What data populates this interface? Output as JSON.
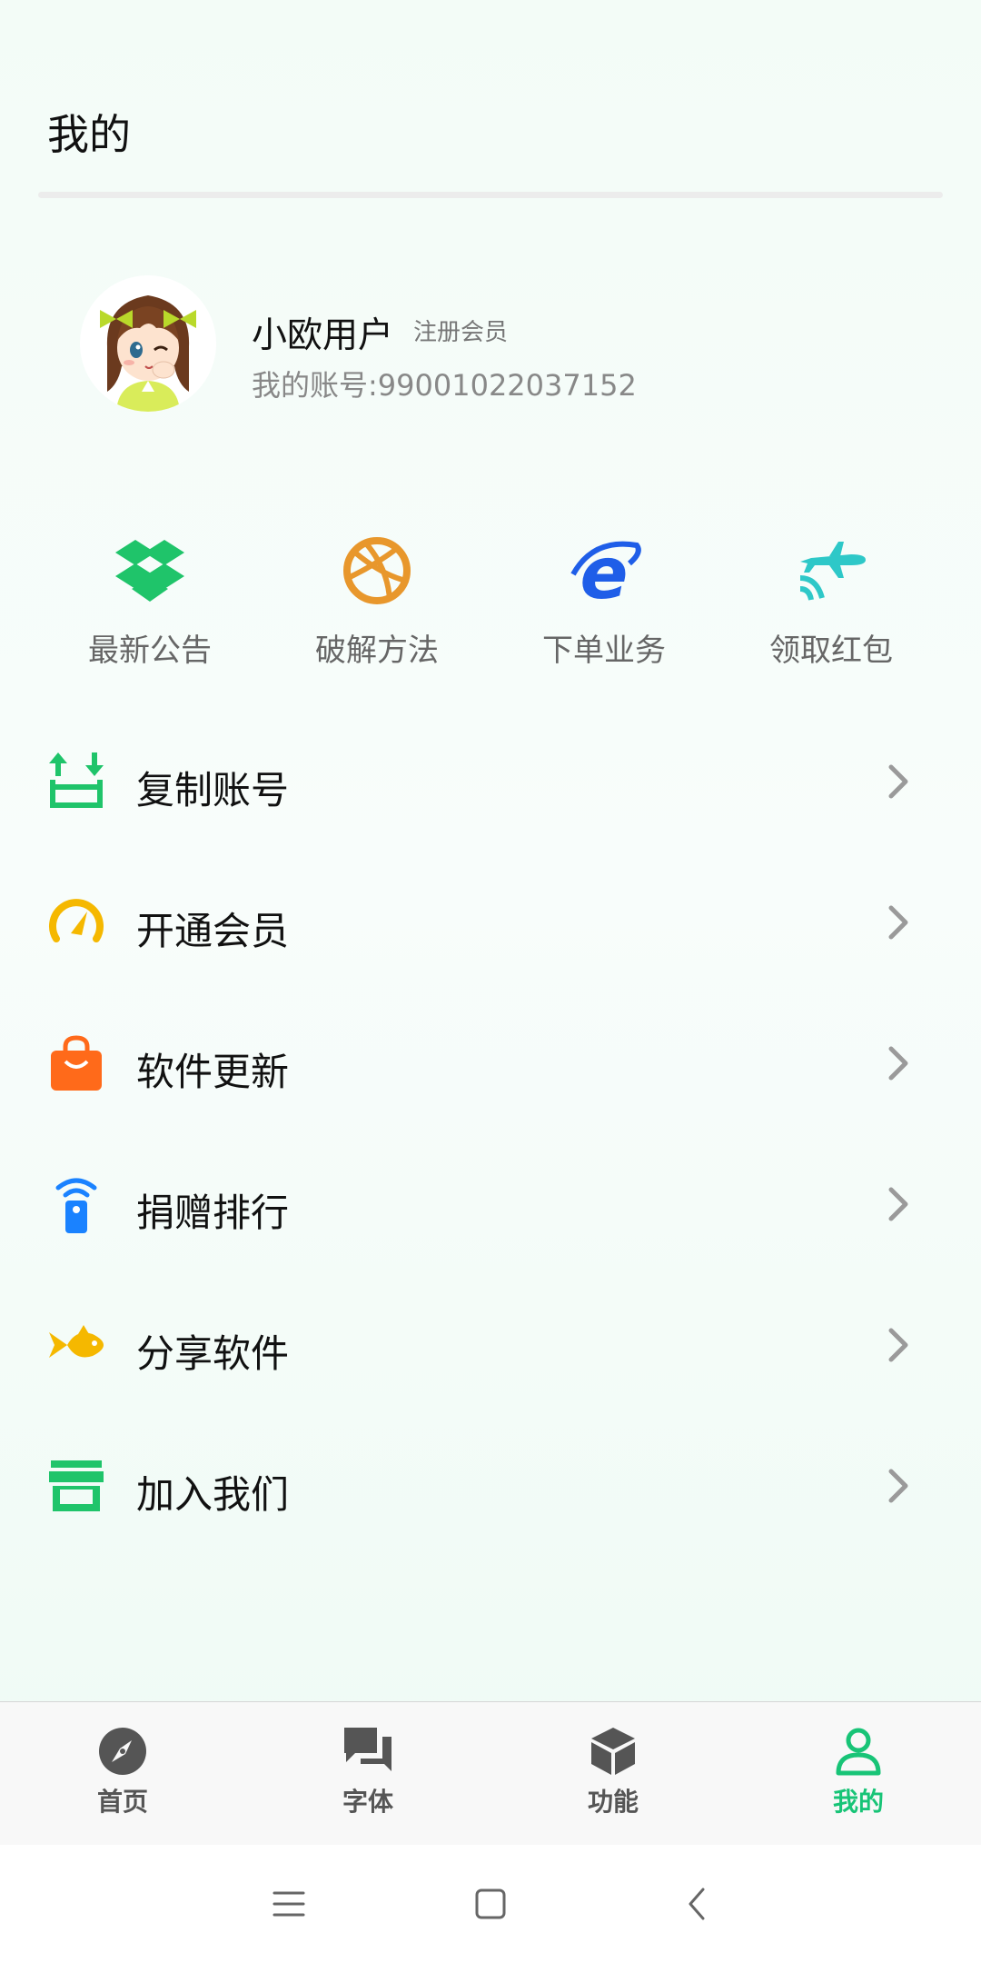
{
  "header": {
    "title": "我的"
  },
  "profile": {
    "name": "小欧用户",
    "badge": "注册会员",
    "account": "我的账号:99001022037152"
  },
  "quick_actions": [
    {
      "label": "最新公告",
      "icon": "dropbox-icon",
      "color": "#1fc46a"
    },
    {
      "label": "破解方法",
      "icon": "dribbble-icon",
      "color": "#e8972c"
    },
    {
      "label": "下单业务",
      "icon": "internet-explorer-icon",
      "color": "#1f5ee8"
    },
    {
      "label": "领取红包",
      "icon": "plane-signal-icon",
      "color": "#2ec8c8"
    }
  ],
  "menu": [
    {
      "label": "复制账号",
      "icon": "transfer-icon",
      "color": "#1fc46a"
    },
    {
      "label": "开通会员",
      "icon": "speedometer-icon",
      "color": "#f5b800"
    },
    {
      "label": "软件更新",
      "icon": "shopping-bag-icon",
      "color": "#ff6a1a"
    },
    {
      "label": "捐赠排行",
      "icon": "remote-signal-icon",
      "color": "#1a82ff"
    },
    {
      "label": "分享软件",
      "icon": "fish-icon",
      "color": "#f5b800"
    },
    {
      "label": "加入我们",
      "icon": "store-icon",
      "color": "#1fc46a"
    }
  ],
  "bottom_nav": [
    {
      "label": "首页",
      "icon": "compass-icon"
    },
    {
      "label": "字体",
      "icon": "chat-icon"
    },
    {
      "label": "功能",
      "icon": "cube-icon"
    },
    {
      "label": "我的",
      "icon": "person-icon",
      "active": true
    }
  ],
  "colors": {
    "accent": "#18c477",
    "nav_inactive": "#555555"
  }
}
